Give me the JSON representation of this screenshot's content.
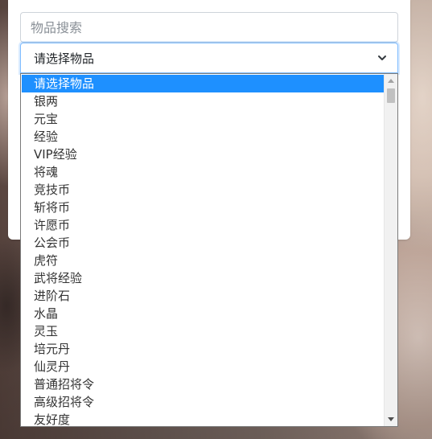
{
  "search": {
    "placeholder": "物品搜索"
  },
  "item_select": {
    "selected_label": "请选择物品",
    "options": [
      "请选择物品",
      "银两",
      "元宝",
      "经验",
      "VIP经验",
      "将魂",
      "竞技币",
      "斩将币",
      "许愿币",
      "公会币",
      "虎符",
      "武将经验",
      "进阶石",
      "水晶",
      "灵玉",
      "培元丹",
      "仙灵丹",
      "普通招将令",
      "高级招将令",
      "友好度"
    ],
    "highlighted_index": 0
  },
  "colors": {
    "highlight": "#1e90ff",
    "focus_border": "#80bdff"
  },
  "icons": {
    "select_chevron": "chevron-down-icon",
    "scroll_up": "scroll-up-arrow-icon",
    "scroll_down": "scroll-down-arrow-icon"
  }
}
